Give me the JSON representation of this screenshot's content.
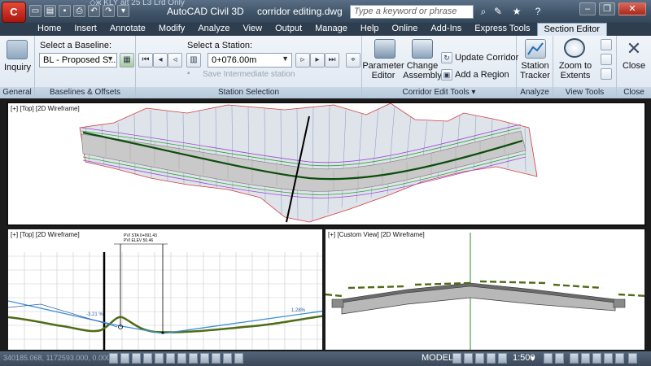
{
  "titlebar": {
    "app_button": "C",
    "file_title": "◇ж KLY alt 25 L3 Lrd Only",
    "app_name": "AutoCAD Civil 3D",
    "document": "corridor editing.dwg",
    "search_placeholder": "Type a keyword or phrase",
    "qat_icons": [
      "new-icon",
      "open-icon",
      "save-icon",
      "print-icon",
      "undo-icon",
      "redo-icon",
      "dropdown-icon"
    ],
    "title_icons": [
      "binoculars-icon",
      "communication-icon",
      "favorites-icon",
      "help-icon"
    ],
    "window_controls": {
      "minimize": "–",
      "restore": "❐",
      "close": "✕"
    }
  },
  "tabs": [
    "Home",
    "Insert",
    "Annotate",
    "Modify",
    "Analyze",
    "View",
    "Output",
    "Manage",
    "Help",
    "Online",
    "Add-Ins",
    "Express Tools",
    "Section Editor"
  ],
  "active_tab": "Section Editor",
  "ribbon": {
    "general": {
      "title": "General",
      "inquiry": "Inquiry"
    },
    "baselines": {
      "title": "Baselines & Offsets",
      "select_label": "Select a Baseline:",
      "baseline_value": "BL - Proposed S..."
    },
    "station": {
      "title": "Station Selection",
      "select_label": "Select a Station:",
      "station_value": "0+076.00m",
      "save_label": "Save Intermediate station"
    },
    "corridor_edit": {
      "title": "Corridor Edit Tools",
      "parameter_editor": "Parameter Editor",
      "parameter_line1": "Parameter",
      "parameter_line2": "Editor",
      "change_line1": "Change",
      "change_line2": "Assembly",
      "update_corridor": "Update Corridor",
      "add_region": "Add a Region"
    },
    "analyze": {
      "title": "Analyze",
      "station_line1": "Station",
      "station_line2": "Tracker"
    },
    "view_tools": {
      "title": "View Tools",
      "zoom_line1": "Zoom to",
      "zoom_line2": "Extents"
    },
    "close": {
      "title": "Close",
      "label": "Close"
    }
  },
  "viewports": {
    "top": {
      "label": "[+] [Top] [2D Wireframe]"
    },
    "profile": {
      "label": "[+] [Top] [2D Wireframe]",
      "pvi_sta": "PVI STA 0+091.43",
      "pvi_elev": "PVI ELEV 50.46",
      "grade_left": "-3.21 %",
      "grade_right": "1.28%"
    },
    "section": {
      "label": "[+] [Custom View] [2D Wireframe]"
    }
  },
  "statusbar": {
    "coordinates": "340185.068, 1172593.000, 0.000",
    "model": "MODEL",
    "scale": "1:500",
    "scale_arrow": "▾"
  },
  "colors": {
    "titlebar": "#3f5367",
    "ribbon_bg": "#e8eef5",
    "alignment": "#0c4d0c",
    "terrain": "#4e6b15",
    "profile_line": "#3d8fd6"
  }
}
